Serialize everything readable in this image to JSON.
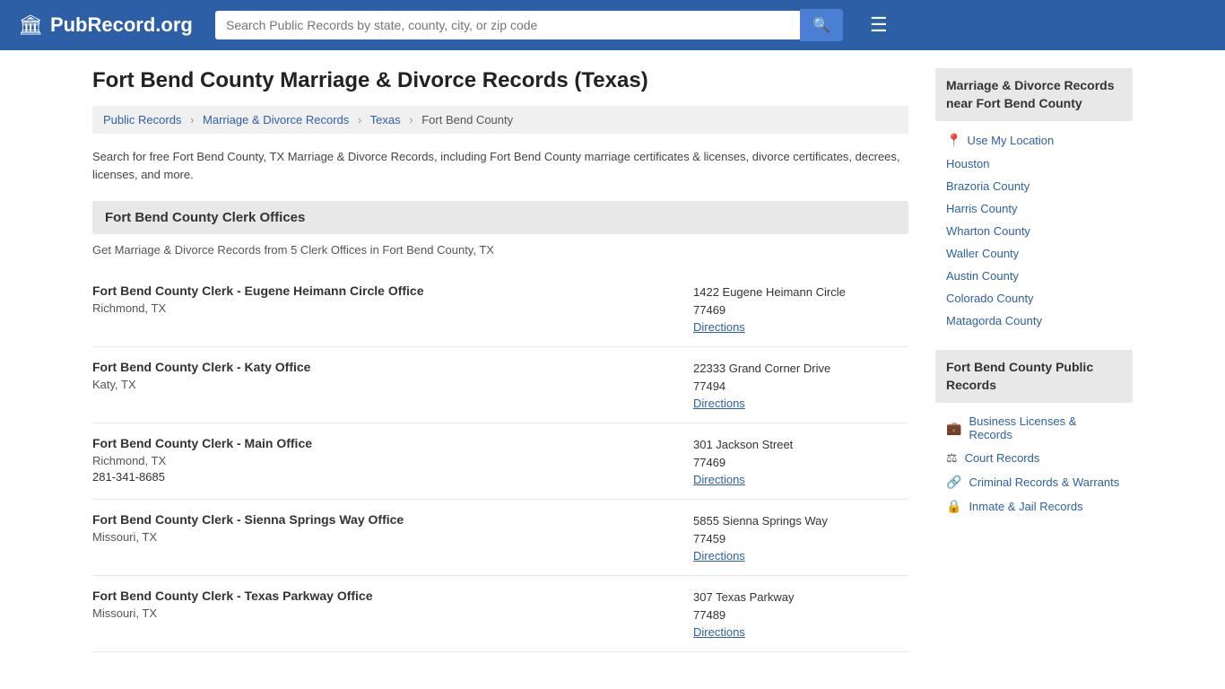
{
  "header": {
    "logo_icon": "🏛",
    "logo_text": "PubRecord.org",
    "search_placeholder": "Search Public Records by state, county, city, or zip code",
    "search_icon": "🔍",
    "menu_icon": "☰"
  },
  "page": {
    "title": "Fort Bend County Marriage & Divorce Records (Texas)",
    "breadcrumb": {
      "items": [
        "Public Records",
        "Marriage & Divorce Records",
        "Texas",
        "Fort Bend County"
      ]
    },
    "description": "Search for free Fort Bend County, TX Marriage & Divorce Records, including Fort Bend County marriage certificates & licenses, divorce certificates, decrees, licenses, and more.",
    "section_title": "Fort Bend County Clerk Offices",
    "section_subtitle": "Get Marriage & Divorce Records from 5 Clerk Offices in Fort Bend County, TX",
    "offices": [
      {
        "name": "Fort Bend County Clerk - Eugene Heimann Circle Office",
        "city": "Richmond, TX",
        "phone": "",
        "address": "1422 Eugene Heimann Circle\n77469",
        "directions_label": "Directions"
      },
      {
        "name": "Fort Bend County Clerk - Katy Office",
        "city": "Katy, TX",
        "phone": "",
        "address": "22333 Grand Corner Drive\n77494",
        "directions_label": "Directions"
      },
      {
        "name": "Fort Bend County Clerk - Main Office",
        "city": "Richmond, TX",
        "phone": "281-341-8685",
        "address": "301 Jackson Street\n77469",
        "directions_label": "Directions"
      },
      {
        "name": "Fort Bend County Clerk - Sienna Springs Way Office",
        "city": "Missouri, TX",
        "phone": "",
        "address": "5855 Sienna Springs Way\n77459",
        "directions_label": "Directions"
      },
      {
        "name": "Fort Bend County Clerk - Texas Parkway Office",
        "city": "Missouri, TX",
        "phone": "",
        "address": "307 Texas Parkway\n77489",
        "directions_label": "Directions"
      }
    ]
  },
  "sidebar": {
    "nearby_title": "Marriage & Divorce Records near Fort Bend County",
    "use_location_label": "Use My Location",
    "nearby_items": [
      "Houston",
      "Brazoria County",
      "Harris County",
      "Wharton County",
      "Waller County",
      "Austin County",
      "Colorado County",
      "Matagorda County"
    ],
    "public_records_title": "Fort Bend County Public Records",
    "public_records_items": [
      {
        "icon": "💼",
        "label": "Business Licenses & Records"
      },
      {
        "icon": "⚖",
        "label": "Court Records"
      },
      {
        "icon": "🔗",
        "label": "Criminal Records & Warrants"
      },
      {
        "icon": "🔒",
        "label": "Inmate & Jail Records"
      }
    ]
  }
}
